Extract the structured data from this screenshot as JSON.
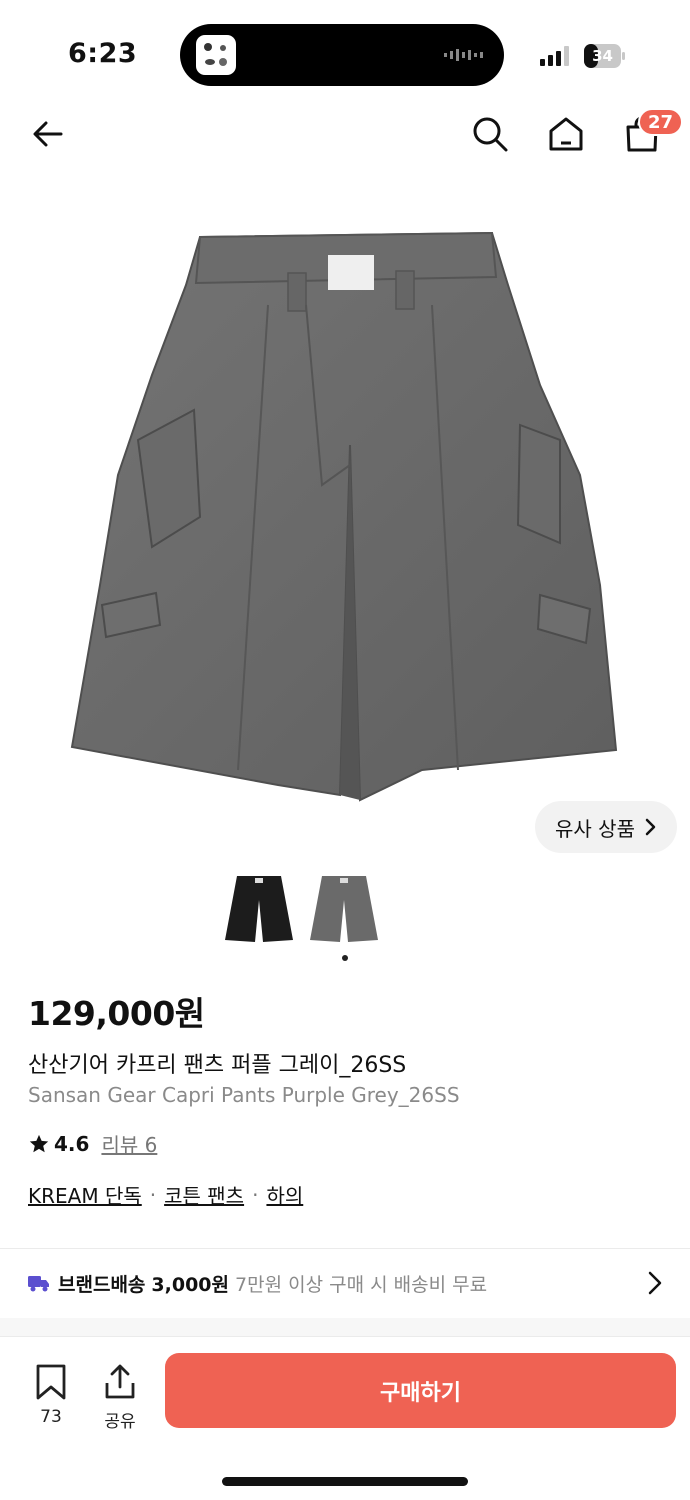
{
  "status_bar": {
    "time": "6:23",
    "battery": "34"
  },
  "nav": {
    "icons": [
      "back-arrow-icon",
      "search-icon",
      "home-icon",
      "shopping-bag-icon"
    ],
    "cart_count": "27"
  },
  "product": {
    "similar_label": "유사 상품",
    "price": "129,000원",
    "name_ko": "산산기어 카프리 팬츠 퍼플 그레이_26SS",
    "name_en": "Sansan Gear Capri Pants Purple Grey_26SS",
    "rating": "4.6",
    "review_label": "리뷰 6",
    "tags": [
      "KREAM 단독",
      "코튼 팬츠",
      "하의"
    ]
  },
  "shipping": {
    "label": "브랜드배송",
    "price": "3,000원",
    "note": "7만원 이상 구매 시 배송비 무료"
  },
  "bottom": {
    "bookmark_count": "73",
    "share_label": "공유",
    "buy_label": "구매하기"
  },
  "colors": {
    "accent": "#ef6253",
    "ship_icon": "#5b4fcf",
    "garment": "#6a6a6a"
  }
}
